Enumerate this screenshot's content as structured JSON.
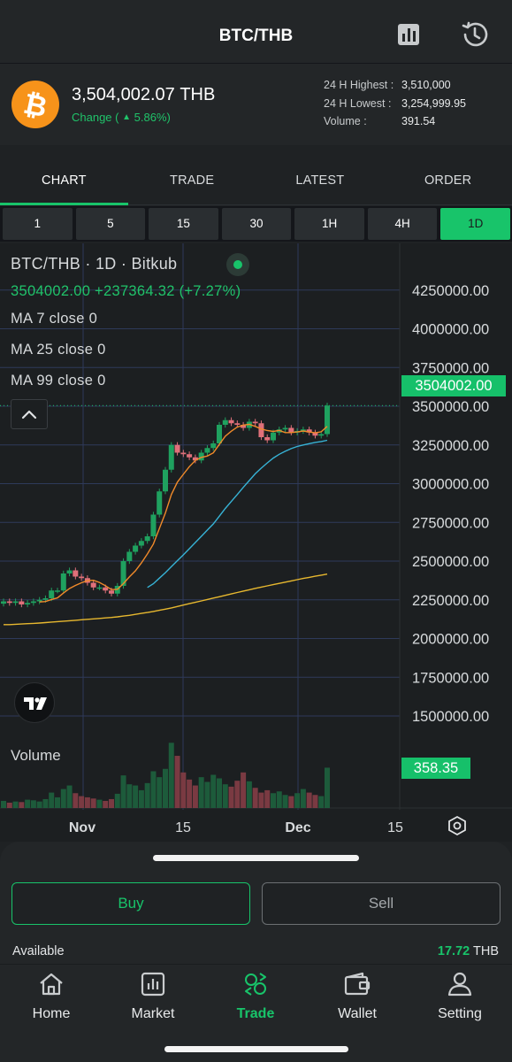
{
  "header": {
    "title": "BTC/THB",
    "chart_icon": "bar-chart-icon",
    "history_icon": "history-icon"
  },
  "summary": {
    "coin_icon": "bitcoin-icon",
    "coin_symbol": "₿",
    "price": "3,504,002.07",
    "currency": "THB",
    "change_label": "Change (",
    "change_value": "5.86%)",
    "stats": [
      {
        "label": "24 H Highest",
        "sep": ":",
        "value": "3,510,000"
      },
      {
        "label": "24 H Lowest",
        "sep": ":",
        "value": "3,254,999.95"
      },
      {
        "label": "Volume",
        "sep": ":",
        "value": "391.54"
      }
    ]
  },
  "tabs": [
    "CHART",
    "TRADE",
    "LATEST",
    "ORDER"
  ],
  "active_tab": "CHART",
  "intervals": [
    "1",
    "5",
    "15",
    "30",
    "1H",
    "4H",
    "1D"
  ],
  "active_interval": "1D",
  "chart": {
    "legend": {
      "title": "BTC/THB · 1D · Bitkub",
      "price_line": "3504002.00  +237364.32 (+7.27%)",
      "ma7": "MA 7 close 0",
      "ma25": "MA 25 close 0",
      "ma99": "MA 99 close 0"
    },
    "last_price_tag": "3504002.00",
    "volume_label": "Volume",
    "volume_tag": "358.35",
    "colors": {
      "up": "#1fa15f",
      "down": "#e0707a",
      "ma7": "#f08a2a",
      "ma25": "#37b3d6",
      "ma99": "#e7b82f",
      "grid": "#2e3a5a"
    }
  },
  "chart_data": {
    "type": "candlestick",
    "title": "BTC/THB · 1D · Bitkub",
    "y_ticks": [
      "4250000.00",
      "4000000.00",
      "3750000.00",
      "3500000.00",
      "3250000.00",
      "3000000.00",
      "2750000.00",
      "2500000.00",
      "2250000.00",
      "2000000.00",
      "1750000.00",
      "1500000.00"
    ],
    "x_ticks": [
      "Nov",
      "15",
      "Dec",
      "15"
    ],
    "ylim": [
      1380000,
      4380000
    ],
    "close": [
      2240000,
      2230000,
      2240000,
      2220000,
      2230000,
      2240000,
      2250000,
      2260000,
      2310000,
      2310000,
      2420000,
      2440000,
      2400000,
      2390000,
      2360000,
      2330000,
      2330000,
      2310000,
      2290000,
      2340000,
      2500000,
      2560000,
      2600000,
      2630000,
      2660000,
      2800000,
      2950000,
      3090000,
      3250000,
      3200000,
      3190000,
      3170000,
      3150000,
      3200000,
      3230000,
      3260000,
      3380000,
      3410000,
      3390000,
      3380000,
      3360000,
      3400000,
      3390000,
      3300000,
      3280000,
      3330000,
      3350000,
      3360000,
      3330000,
      3340000,
      3350000,
      3330000,
      3310000,
      3320000,
      3504002
    ],
    "ma7": [
      null,
      null,
      null,
      null,
      null,
      null,
      2236000,
      2239000,
      2252000,
      2262000,
      2294000,
      2323000,
      2343000,
      2360000,
      2374000,
      2376000,
      2362000,
      2341000,
      2316000,
      2318000,
      2355000,
      2398000,
      2437000,
      2488000,
      2546000,
      2610000,
      2710000,
      2810000,
      2930000,
      3010000,
      3060000,
      3110000,
      3150000,
      3170000,
      3178000,
      3199000,
      3253000,
      3306000,
      3339000,
      3365000,
      3378000,
      3383000,
      3370000,
      3353000,
      3343000,
      3337000,
      3344000,
      3330000,
      3330000,
      3334000,
      3340000,
      3334000,
      3328000,
      3335000,
      3370000
    ],
    "ma25": [
      null,
      null,
      null,
      null,
      null,
      null,
      null,
      null,
      null,
      null,
      null,
      null,
      null,
      null,
      null,
      null,
      null,
      null,
      null,
      null,
      null,
      null,
      null,
      null,
      2330000,
      2354000,
      2390000,
      2425000,
      2464000,
      2503000,
      2540000,
      2580000,
      2620000,
      2660000,
      2700000,
      2740000,
      2790000,
      2840000,
      2885000,
      2930000,
      2976000,
      3020000,
      3064000,
      3100000,
      3134000,
      3165000,
      3190000,
      3209000,
      3226000,
      3240000,
      3250000,
      3258000,
      3266000,
      3272000,
      3280000
    ],
    "ma99": [
      2090000,
      2090000,
      2092000,
      2094000,
      2096000,
      2098000,
      2100000,
      2103000,
      2106000,
      2109000,
      2112000,
      2115000,
      2118000,
      2121000,
      2124000,
      2127000,
      2130000,
      2133000,
      2136000,
      2140000,
      2145000,
      2150000,
      2156000,
      2162000,
      2168000,
      2175000,
      2182000,
      2190000,
      2198000,
      2207000,
      2216000,
      2225000,
      2234000,
      2243000,
      2252000,
      2261000,
      2270000,
      2279000,
      2288000,
      2297000,
      2306000,
      2315000,
      2324000,
      2332000,
      2340000,
      2348000,
      2356000,
      2364000,
      2372000,
      2380000,
      2388000,
      2395000,
      2402000,
      2409000,
      2416000
    ],
    "volume": [
      12,
      9,
      11,
      10,
      14,
      13,
      11,
      15,
      26,
      18,
      32,
      38,
      25,
      20,
      18,
      16,
      14,
      12,
      15,
      24,
      55,
      40,
      38,
      30,
      42,
      62,
      52,
      66,
      110,
      88,
      60,
      48,
      38,
      52,
      44,
      56,
      50,
      40,
      36,
      46,
      60,
      45,
      34,
      26,
      30,
      25,
      28,
      22,
      20,
      25,
      32,
      26,
      22,
      20,
      68
    ],
    "last_price": 3504002
  },
  "trade": {
    "buy_label": "Buy",
    "sell_label": "Sell",
    "available_label": "Available",
    "available_amount": "17.72",
    "available_currency": "THB"
  },
  "nav": [
    {
      "label": "Home",
      "icon": "home-icon"
    },
    {
      "label": "Market",
      "icon": "market-icon"
    },
    {
      "label": "Trade",
      "icon": "trade-icon"
    },
    {
      "label": "Wallet",
      "icon": "wallet-icon"
    },
    {
      "label": "Setting",
      "icon": "user-icon"
    }
  ],
  "active_nav": "Trade"
}
